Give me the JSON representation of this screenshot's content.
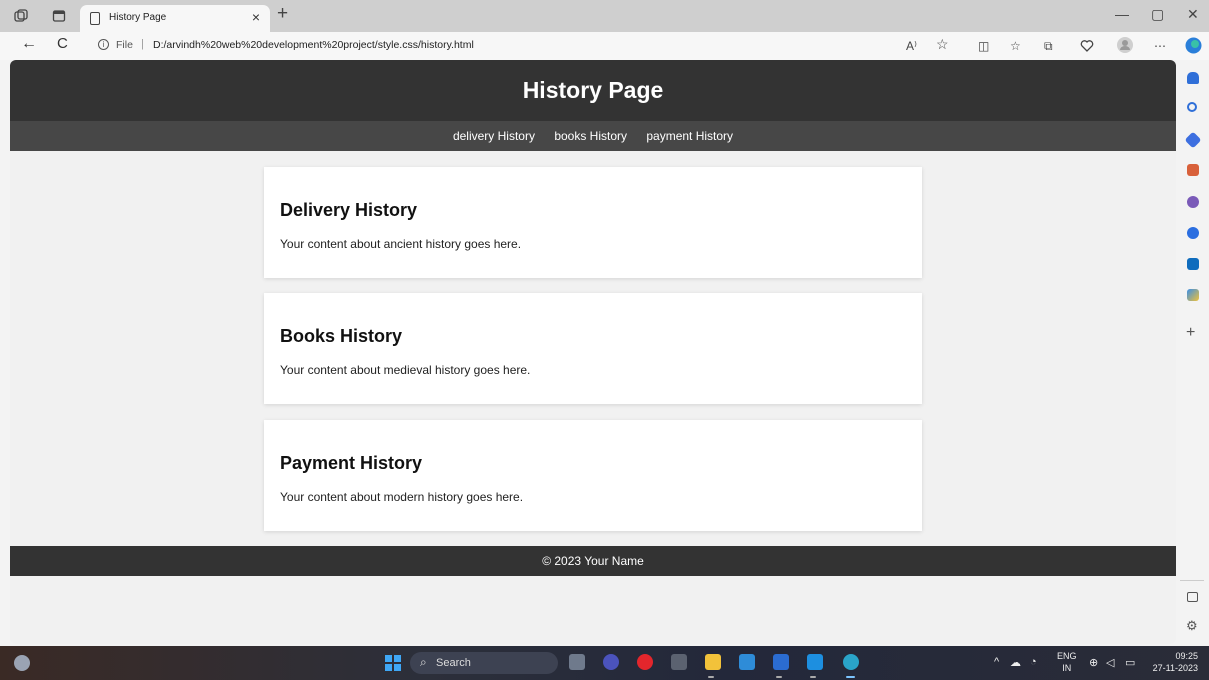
{
  "browser": {
    "tab_title": "History Page",
    "tab_close": "×",
    "new_tab": "+",
    "address": {
      "scheme_label": "File",
      "separator": "|",
      "url": "D:/arvindh%20web%20development%20project/style.css/history.html"
    },
    "icons": {
      "back": "←",
      "refresh": "C",
      "read_aloud": "A⁾",
      "favorite": "☆",
      "split": "◫",
      "favorites_bar": "☆",
      "collections": "⧉",
      "more": "⋯"
    },
    "window_controls": {
      "minimize": "—",
      "restore": "▢",
      "close": "✕"
    }
  },
  "page": {
    "title": "History Page",
    "nav": [
      {
        "label": "delivery History"
      },
      {
        "label": "books History"
      },
      {
        "label": "payment History"
      }
    ],
    "sections": [
      {
        "heading": "Delivery History",
        "text": "Your content about ancient history goes here."
      },
      {
        "heading": "Books History",
        "text": "Your content about medieval history goes here."
      },
      {
        "heading": "Payment History",
        "text": "Your content about modern history goes here."
      }
    ],
    "footer": "© 2023 Your Name"
  },
  "taskbar": {
    "search_label": "Search",
    "language": {
      "line1": "ENG",
      "line2": "IN"
    },
    "time": "09:25",
    "date": "27-11-2023"
  },
  "colors": {
    "header_bg": "#333333",
    "nav_bg": "#474747",
    "page_bg": "#f1f1f1",
    "card_bg": "#ffffff"
  }
}
